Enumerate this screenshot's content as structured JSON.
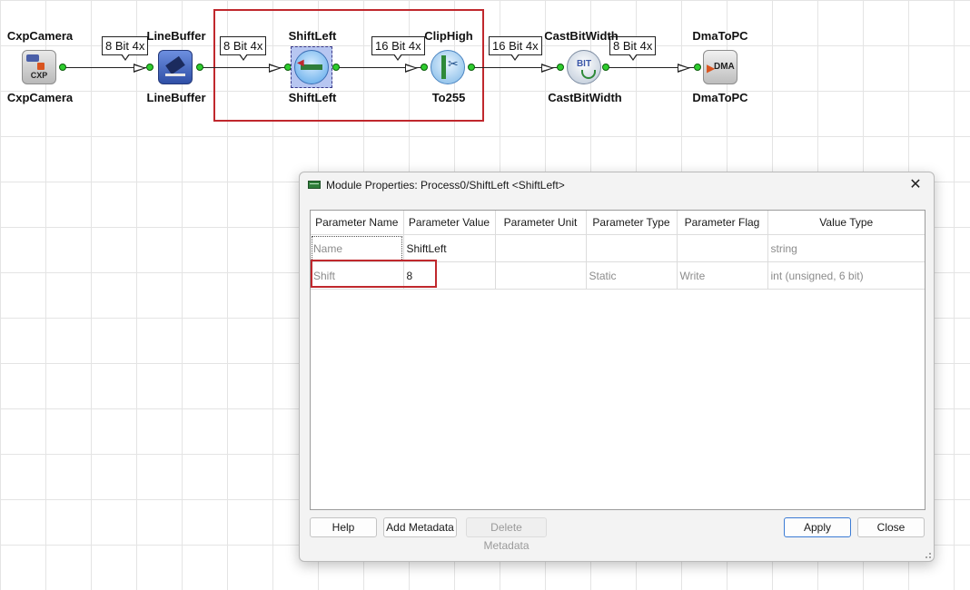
{
  "diagram": {
    "modules": [
      {
        "id": "cxpcamera",
        "top_label": "CxpCamera",
        "bottom_label": "CxpCamera",
        "icon": "cxp-camera-icon",
        "icon_text": "CXP"
      },
      {
        "id": "linebuffer",
        "top_label": "LineBuffer",
        "bottom_label": "LineBuffer",
        "icon": "line-buffer-icon"
      },
      {
        "id": "shiftleft",
        "top_label": "ShiftLeft",
        "bottom_label": "ShiftLeft",
        "icon": "shift-left-icon"
      },
      {
        "id": "cliphigh",
        "top_label": "ClipHigh",
        "bottom_label": "To255",
        "icon": "clip-high-icon"
      },
      {
        "id": "castbitwidth",
        "top_label": "CastBitWidth",
        "bottom_label": "CastBitWidth",
        "icon": "cast-bit-width-icon",
        "icon_text": "BIT"
      },
      {
        "id": "dmatopc",
        "top_label": "DmaToPC",
        "bottom_label": "DmaToPC",
        "icon": "dma-icon",
        "icon_text": "DMA"
      }
    ],
    "links": [
      {
        "label": "8 Bit 4x"
      },
      {
        "label": "8 Bit 4x"
      },
      {
        "label": "16 Bit 4x"
      },
      {
        "label": "16 Bit 4x"
      },
      {
        "label": "8 Bit 4x"
      }
    ],
    "highlight_color": "#c0282d"
  },
  "dialog": {
    "title": "Module Properties: Process0/ShiftLeft <ShiftLeft>",
    "title_icon": "module-icon",
    "close_symbol": "✕",
    "columns": [
      "Parameter Name",
      "Parameter Value",
      "Parameter Unit",
      "Parameter Type",
      "Parameter Flag",
      "Value Type"
    ],
    "rows": [
      {
        "name": "Name",
        "value": "ShiftLeft",
        "unit": "",
        "type": "",
        "flag": "",
        "value_type": "string"
      },
      {
        "name": "Shift",
        "value": "8",
        "unit": "",
        "type": "Static",
        "flag": "Write",
        "value_type": "int (unsigned, 6 bit)"
      }
    ],
    "buttons": {
      "help": "Help",
      "add_metadata": "Add Metadata",
      "delete_metadata": "Delete Metadata",
      "apply": "Apply",
      "close": "Close"
    }
  }
}
